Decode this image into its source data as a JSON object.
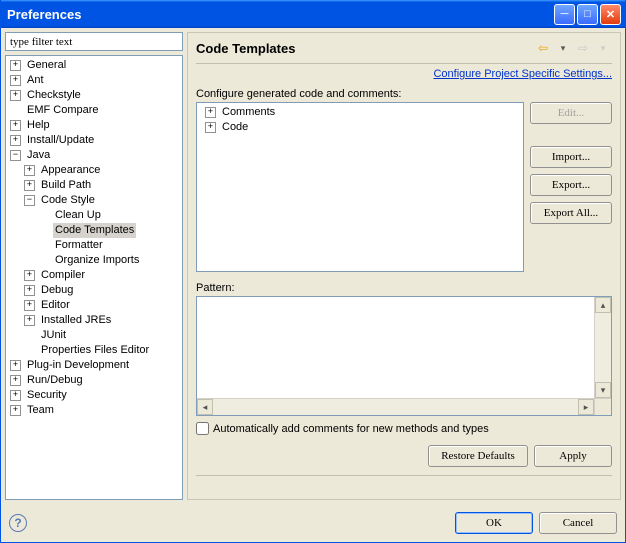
{
  "window": {
    "title": "Preferences"
  },
  "filter": {
    "placeholder": "type filter text"
  },
  "tree": {
    "general": "General",
    "ant": "Ant",
    "checkstyle": "Checkstyle",
    "emf_compare": "EMF Compare",
    "help": "Help",
    "install_update": "Install/Update",
    "java": "Java",
    "java_children": {
      "appearance": "Appearance",
      "build_path": "Build Path",
      "code_style": "Code Style",
      "code_style_children": {
        "clean_up": "Clean Up",
        "code_templates": "Code Templates",
        "formatter": "Formatter",
        "organize_imports": "Organize Imports"
      },
      "compiler": "Compiler",
      "debug": "Debug",
      "editor": "Editor",
      "installed_jres": "Installed JREs",
      "junit": "JUnit",
      "properties_files_editor": "Properties Files Editor"
    },
    "plugin_dev": "Plug-in Development",
    "run_debug": "Run/Debug",
    "security": "Security",
    "team": "Team"
  },
  "page": {
    "heading": "Code Templates",
    "config_link": "Configure Project Specific Settings...",
    "configure_label": "Configure generated code and comments:",
    "templates": {
      "comments": "Comments",
      "code": "Code"
    },
    "buttons": {
      "edit": "Edit...",
      "import": "Import...",
      "export": "Export...",
      "export_all": "Export All..."
    },
    "pattern_label": "Pattern:",
    "auto_comments_label": "Automatically add comments for new methods and types",
    "restore_defaults": "Restore Defaults",
    "apply": "Apply"
  },
  "dialog": {
    "ok": "OK",
    "cancel": "Cancel"
  }
}
